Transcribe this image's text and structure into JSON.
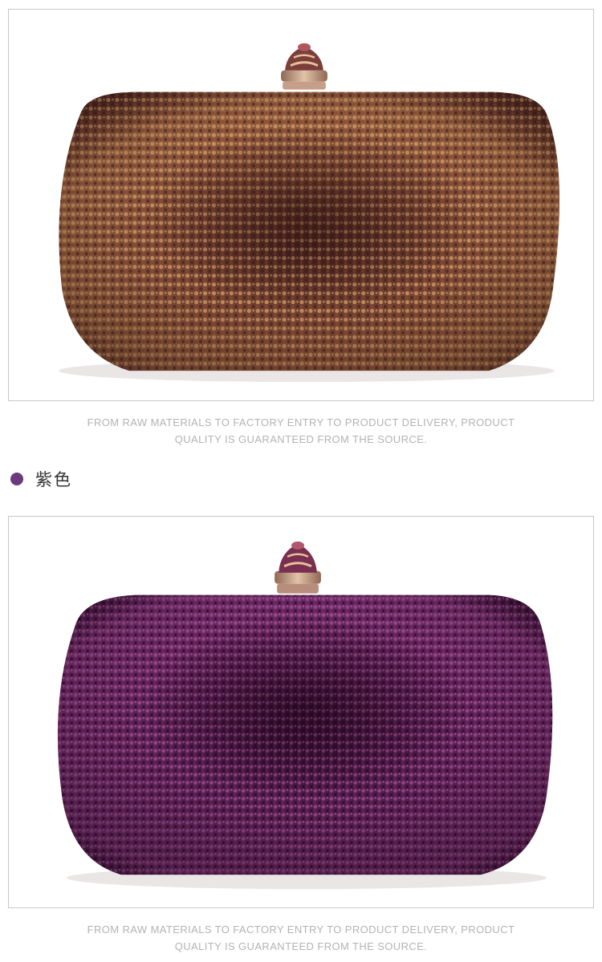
{
  "products": [
    {
      "photo": "clutch-bag-champagne-brown",
      "caption_line1": "FROM RAW MATERIALS TO FACTORY ENTRY TO PRODUCT DELIVERY, PRODUCT",
      "caption_line2": "QUALITY IS GUARANTEED FROM THE SOURCE."
    },
    {
      "photo": "clutch-bag-purple",
      "caption_line1": "FROM RAW MATERIALS TO FACTORY ENTRY TO PRODUCT DELIVERY, PRODUCT",
      "caption_line2": "QUALITY IS GUARANTEED FROM THE SOURCE."
    }
  ],
  "color_option": {
    "label": "紫色",
    "dot_color": "#6a3a7c"
  },
  "colors": {
    "brown_base": "#6e3d2e",
    "brown_light": "#c98c5a",
    "brown_dark": "#3f1f1c",
    "purple_base": "#5a1f52",
    "purple_light": "#a14d95",
    "purple_dark": "#2a0c28",
    "clasp_gold": "#c7a089"
  }
}
